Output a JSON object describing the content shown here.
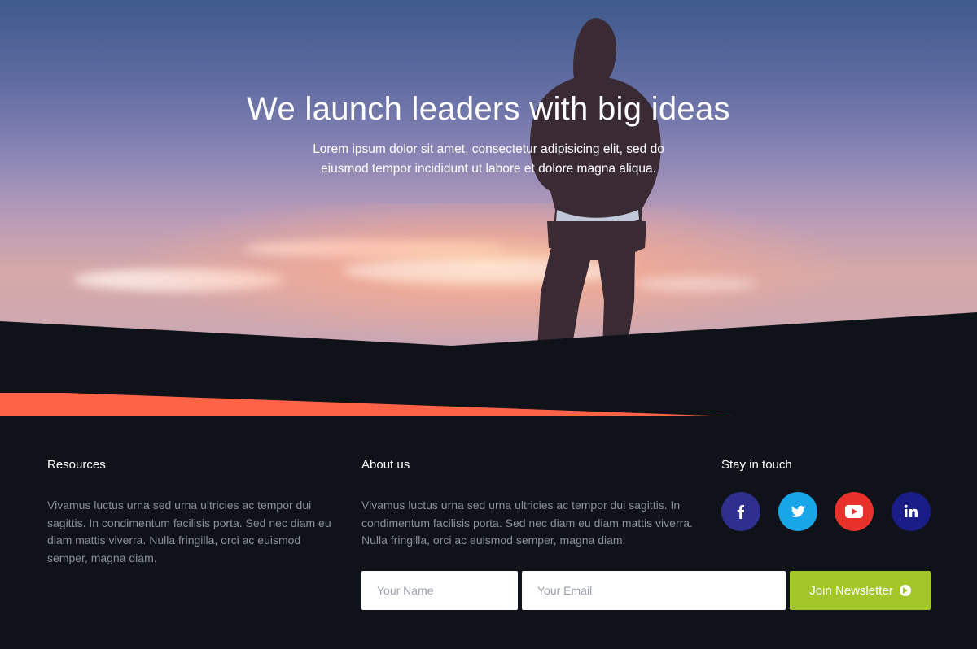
{
  "hero": {
    "title": "We launch leaders with big ideas",
    "subtitle": "Lorem ipsum dolor sit amet, consectetur adipisicing elit, sed do eiusmod tempor incididunt ut labore et dolore magna aliqua."
  },
  "footer": {
    "resources": {
      "heading": "Resources",
      "text": "Vivamus luctus urna sed urna ultricies ac tempor dui sagittis. In condimentum facilisis porta. Sed nec diam eu diam mattis viverra. Nulla fringilla, orci ac euismod semper, magna diam."
    },
    "about": {
      "heading": "About us",
      "text": "Vivamus luctus urna sed urna ultricies ac tempor dui sagittis. In condimentum facilisis porta. Sed nec diam eu diam mattis viverra. Nulla fringilla, orci ac euismod semper, magna diam."
    },
    "contact": {
      "heading": "Stay in touch",
      "socials": [
        {
          "name": "facebook-icon",
          "color": "#2e2f8f"
        },
        {
          "name": "twitter-icon",
          "color": "#19a6e8"
        },
        {
          "name": "youtube-icon",
          "color": "#e8312a"
        },
        {
          "name": "linkedin-icon",
          "color": "#1a1c87"
        }
      ]
    },
    "newsletter": {
      "name_placeholder": "Your Name",
      "email_placeholder": "Your Email",
      "button_label": "Join Newsletter",
      "button_color": "#a3c62b"
    }
  },
  "colors": {
    "accent_stripe": "#ff6347",
    "footer_bg": "#0f1218"
  }
}
